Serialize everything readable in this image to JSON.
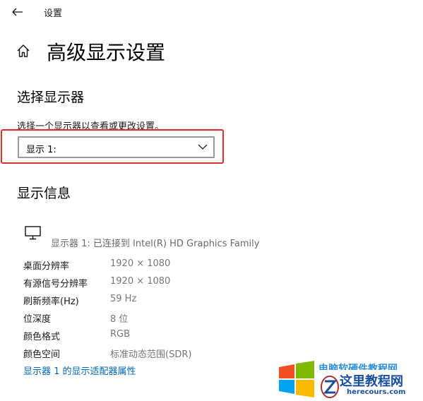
{
  "window": {
    "title": "设置",
    "back_icon": "arrow-left-icon"
  },
  "header": {
    "home_icon": "home-icon",
    "title": "高级显示设置"
  },
  "select_section": {
    "heading": "选择显示器",
    "description": "选择一个显示器以查看或更改设置。",
    "dropdown": {
      "selected": "显示 1:",
      "icon": "chevron-down-icon"
    },
    "highlight_color": "#e02f2f"
  },
  "info_section": {
    "heading": "显示信息",
    "monitor_icon": "monitor-icon",
    "monitor_line": "显示器 1: 已连接到 Intel(R) HD Graphics Family",
    "rows": [
      {
        "label": "桌面分辨率",
        "value": "1920 × 1080"
      },
      {
        "label": "有源信号分辨率",
        "value": "1920 × 1080"
      },
      {
        "label": "刷新频率(Hz)",
        "value": "59 Hz"
      },
      {
        "label": "位深度",
        "value": "8 位"
      },
      {
        "label": "颜色格式",
        "value": "RGB"
      },
      {
        "label": "颜色空间",
        "value": "标准动态范围(SDR)"
      }
    ],
    "adapter_link": "显示器 1 的显示适配器属性",
    "link_color": "#0067b8"
  },
  "watermark": {
    "top_text": "电脑软硬件教程网",
    "main_text": "这里教程网",
    "url": "herecours.com"
  }
}
